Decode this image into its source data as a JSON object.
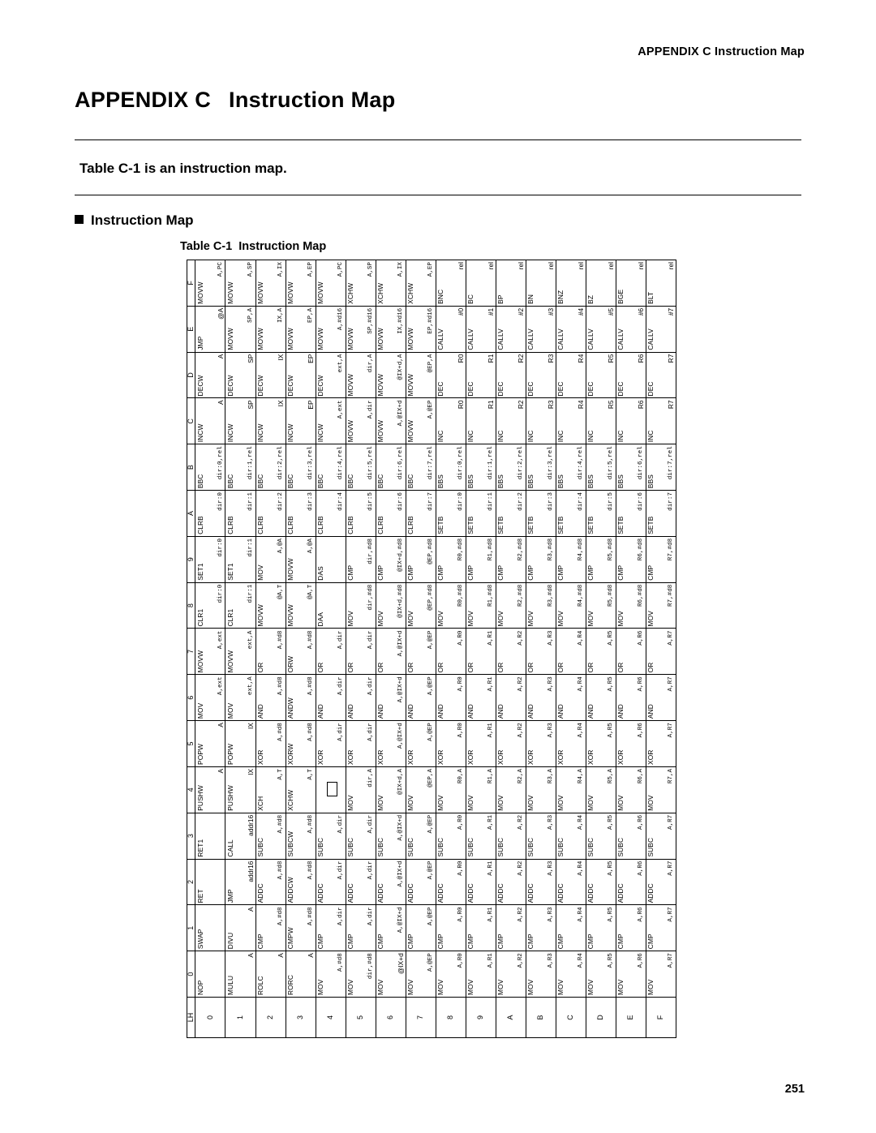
{
  "header": {
    "running_head": "APPENDIX C  Instruction Map",
    "page_number": "251"
  },
  "title": {
    "label": "APPENDIX C",
    "name": "Instruction Map"
  },
  "subtitle": "Table C-1 is an instruction map.",
  "section": "Instruction Map",
  "table_caption": {
    "number": "Table C-1",
    "text": "Instruction Map"
  },
  "table": {
    "corner": "LH",
    "col_headers": [
      "0",
      "1",
      "2",
      "3",
      "4",
      "5",
      "6",
      "7",
      "8",
      "9",
      "A",
      "B",
      "C",
      "D",
      "E",
      "F"
    ],
    "row_headers": [
      "0",
      "1",
      "2",
      "3",
      "4",
      "5",
      "6",
      "7",
      "8",
      "9",
      "A",
      "B",
      "C",
      "D",
      "E",
      "F"
    ],
    "rows": [
      [
        {
          "m": "NOP",
          "o": ""
        },
        {
          "m": "SWAP",
          "o": ""
        },
        {
          "m": "RET",
          "o": ""
        },
        {
          "m": "RET1",
          "o": ""
        },
        {
          "m": "PUSHW",
          "o": "A"
        },
        {
          "m": "POPW",
          "o": "A"
        },
        {
          "m": "MOV",
          "o": "A,ext"
        },
        {
          "m": "MOVW",
          "o": "A,ext"
        },
        {
          "m": "CLR1",
          "o": "dir:0"
        },
        {
          "m": "SET1",
          "o": "dir:0"
        },
        {
          "m": "CLRB",
          "o": "dir:0"
        },
        {
          "m": "BBC",
          "o": "dir:0,rel"
        },
        {
          "m": "INCW",
          "o": "A"
        },
        {
          "m": "DECW",
          "o": "A"
        },
        {
          "m": "JMP",
          "o": "@A"
        },
        {
          "m": "MOVW",
          "o": "A,PC"
        }
      ],
      [
        {
          "m": "MULU",
          "o": "A"
        },
        {
          "m": "DIVU",
          "o": "A"
        },
        {
          "m": "JMP",
          "o": "addr16"
        },
        {
          "m": "CALL",
          "o": "addr16"
        },
        {
          "m": "PUSHW",
          "o": "IX"
        },
        {
          "m": "POPW",
          "o": "IX"
        },
        {
          "m": "MOV",
          "o": "ext,A"
        },
        {
          "m": "MOVW",
          "o": "ext,A"
        },
        {
          "m": "CLR1",
          "o": "dir:1"
        },
        {
          "m": "SET1",
          "o": "dir:1"
        },
        {
          "m": "CLRB",
          "o": "dir:1"
        },
        {
          "m": "BBC",
          "o": "dir:1,rel"
        },
        {
          "m": "INCW",
          "o": "SP"
        },
        {
          "m": "DECW",
          "o": "SP"
        },
        {
          "m": "MOVW",
          "o": "SP,A"
        },
        {
          "m": "MOVW",
          "o": "A,SP"
        }
      ],
      [
        {
          "m": "ROLC",
          "o": "A"
        },
        {
          "m": "CMP",
          "o": "A,#d8"
        },
        {
          "m": "ADDC",
          "o": "A,#d8"
        },
        {
          "m": "SUBC",
          "o": "A,#d8"
        },
        {
          "m": "XCH",
          "o": "A,T"
        },
        {
          "m": "XOR",
          "o": "A,#d8"
        },
        {
          "m": "AND",
          "o": "A,#d8"
        },
        {
          "m": "OR",
          "o": "A,#d8"
        },
        {
          "m": "MOVW",
          "o": "@A,T"
        },
        {
          "m": "MOV",
          "o": "A,@A"
        },
        {
          "m": "CLRB",
          "o": "dir:2"
        },
        {
          "m": "BBC",
          "o": "dir:2,rel"
        },
        {
          "m": "INCW",
          "o": "IX"
        },
        {
          "m": "DECW",
          "o": "IX"
        },
        {
          "m": "MOVW",
          "o": "IX,A"
        },
        {
          "m": "MOVW",
          "o": "A,IX"
        }
      ],
      [
        {
          "m": "RORC",
          "o": "A"
        },
        {
          "m": "CMPW",
          "o": "A,#d8"
        },
        {
          "m": "ADDCW",
          "o": "A,#d8"
        },
        {
          "m": "SUBCW",
          "o": "A,#d8"
        },
        {
          "m": "XCHW",
          "o": "A,T"
        },
        {
          "m": "XORW",
          "o": "A,#d8"
        },
        {
          "m": "ANDW",
          "o": "A,#d8"
        },
        {
          "m": "ORW",
          "o": "A,#d8"
        },
        {
          "m": "MOVW",
          "o": "@A,T"
        },
        {
          "m": "MOVW",
          "o": "A,@A"
        },
        {
          "m": "CLRB",
          "o": "dir:3"
        },
        {
          "m": "BBC",
          "o": "dir:3,rel"
        },
        {
          "m": "INCW",
          "o": "EP"
        },
        {
          "m": "DECW",
          "o": "EP"
        },
        {
          "m": "MOVW",
          "o": "EP,A"
        },
        {
          "m": "MOVW",
          "o": "A,EP"
        }
      ],
      [
        {
          "m": "MOV",
          "o": "A,#d8"
        },
        {
          "m": "CMP",
          "o": "A,dir"
        },
        {
          "m": "ADDC",
          "o": "A,dir"
        },
        {
          "m": "SUBC",
          "o": "A,dir"
        },
        {
          "m": "BOX",
          "o": ""
        },
        {
          "m": "XOR",
          "o": "A,dir"
        },
        {
          "m": "AND",
          "o": "A,dir"
        },
        {
          "m": "OR",
          "o": "A,dir"
        },
        {
          "m": "DAA",
          "o": ""
        },
        {
          "m": "DAS",
          "o": ""
        },
        {
          "m": "CLRB",
          "o": "dir:4"
        },
        {
          "m": "BBC",
          "o": "dir:4,rel"
        },
        {
          "m": "INCW",
          "o": "A,ext"
        },
        {
          "m": "DECW",
          "o": "ext,A"
        },
        {
          "m": "MOVW",
          "o": "A,#d16"
        },
        {
          "m": "MOVW",
          "o": "A,PC"
        }
      ],
      [
        {
          "m": "MOV",
          "o": "dir,#d8"
        },
        {
          "m": "CMP",
          "o": "A,dir"
        },
        {
          "m": "ADDC",
          "o": "A,dir"
        },
        {
          "m": "SUBC",
          "o": "A,dir"
        },
        {
          "m": "MOV",
          "o": "dir,A"
        },
        {
          "m": "XOR",
          "o": "A,dir"
        },
        {
          "m": "AND",
          "o": "A,dir"
        },
        {
          "m": "OR",
          "o": "A,dir"
        },
        {
          "m": "MOV",
          "o": "dir,#d8"
        },
        {
          "m": "CMP",
          "o": "dir,#d8"
        },
        {
          "m": "CLRB",
          "o": "dir:5"
        },
        {
          "m": "BBC",
          "o": "dir:5,rel"
        },
        {
          "m": "MOVW",
          "o": "A,dir"
        },
        {
          "m": "MOVW",
          "o": "dir,A"
        },
        {
          "m": "MOVW",
          "o": "SP,#d16"
        },
        {
          "m": "XCHW",
          "o": "A,SP"
        }
      ],
      [
        {
          "m": "MOV",
          "o": "@IX+d"
        },
        {
          "m": "CMP",
          "o": "A,@IX+d"
        },
        {
          "m": "ADDC",
          "o": "A,@IX+d"
        },
        {
          "m": "SUBC",
          "o": "A,@IX+d"
        },
        {
          "m": "MOV",
          "o": "@IX+d,A"
        },
        {
          "m": "XOR",
          "o": "A,@IX+d"
        },
        {
          "m": "AND",
          "o": "A,@IX+d"
        },
        {
          "m": "OR",
          "o": "A,@IX+d"
        },
        {
          "m": "MOV",
          "o": "@IX+d,#d8"
        },
        {
          "m": "CMP",
          "o": "@IX+d,#d8"
        },
        {
          "m": "CLRB",
          "o": "dir:6"
        },
        {
          "m": "BBC",
          "o": "dir:6,rel"
        },
        {
          "m": "MOVW",
          "o": "A,@IX+d"
        },
        {
          "m": "MOVW",
          "o": "@IX+d,A"
        },
        {
          "m": "MOVW",
          "o": "IX,#d16"
        },
        {
          "m": "XCHW",
          "o": "A,IX"
        }
      ],
      [
        {
          "m": "MOV",
          "o": "A,@EP"
        },
        {
          "m": "CMP",
          "o": "A,@EP"
        },
        {
          "m": "ADDC",
          "o": "A,@EP"
        },
        {
          "m": "SUBC",
          "o": "A,@EP"
        },
        {
          "m": "MOV",
          "o": "@EP,A"
        },
        {
          "m": "XOR",
          "o": "A,@EP"
        },
        {
          "m": "AND",
          "o": "A,@EP"
        },
        {
          "m": "OR",
          "o": "A,@EP"
        },
        {
          "m": "MOV",
          "o": "@EP,#d8"
        },
        {
          "m": "CMP",
          "o": "@EP,#d8"
        },
        {
          "m": "CLRB",
          "o": "dir:7"
        },
        {
          "m": "BBC",
          "o": "dir:7,rel"
        },
        {
          "m": "MOVW",
          "o": "A,@EP"
        },
        {
          "m": "MOVW",
          "o": "@EP,A"
        },
        {
          "m": "MOVW",
          "o": "EP,#d16"
        },
        {
          "m": "XCHW",
          "o": "A,EP"
        }
      ],
      [
        {
          "m": "MOV",
          "o": "A,R0"
        },
        {
          "m": "CMP",
          "o": "A,R0"
        },
        {
          "m": "ADDC",
          "o": "A,R0"
        },
        {
          "m": "SUBC",
          "o": "A,R0"
        },
        {
          "m": "MOV",
          "o": "R0,A"
        },
        {
          "m": "XOR",
          "o": "A,R0"
        },
        {
          "m": "AND",
          "o": "A,R0"
        },
        {
          "m": "OR",
          "o": "A,R0"
        },
        {
          "m": "MOV",
          "o": "R0,#d8"
        },
        {
          "m": "CMP",
          "o": "R0,#d8"
        },
        {
          "m": "SETB",
          "o": "dir:0"
        },
        {
          "m": "BBS",
          "o": "dir:0,rel"
        },
        {
          "m": "INC",
          "o": "R0"
        },
        {
          "m": "DEC",
          "o": "R0"
        },
        {
          "m": "CALLV",
          "o": "#0"
        },
        {
          "m": "BNC",
          "o": "rel"
        }
      ],
      [
        {
          "m": "MOV",
          "o": "A,R1"
        },
        {
          "m": "CMP",
          "o": "A,R1"
        },
        {
          "m": "ADDC",
          "o": "A,R1"
        },
        {
          "m": "SUBC",
          "o": "A,R1"
        },
        {
          "m": "MOV",
          "o": "R1,A"
        },
        {
          "m": "XOR",
          "o": "A,R1"
        },
        {
          "m": "AND",
          "o": "A,R1"
        },
        {
          "m": "OR",
          "o": "A,R1"
        },
        {
          "m": "MOV",
          "o": "R1,#d8"
        },
        {
          "m": "CMP",
          "o": "R1,#d8"
        },
        {
          "m": "SETB",
          "o": "dir:1"
        },
        {
          "m": "BBS",
          "o": "dir:1,rel"
        },
        {
          "m": "INC",
          "o": "R1"
        },
        {
          "m": "DEC",
          "o": "R1"
        },
        {
          "m": "CALLV",
          "o": "#1"
        },
        {
          "m": "BC",
          "o": "rel"
        }
      ],
      [
        {
          "m": "MOV",
          "o": "A,R2"
        },
        {
          "m": "CMP",
          "o": "A,R2"
        },
        {
          "m": "ADDC",
          "o": "A,R2"
        },
        {
          "m": "SUBC",
          "o": "A,R2"
        },
        {
          "m": "MOV",
          "o": "R2,A"
        },
        {
          "m": "XOR",
          "o": "A,R2"
        },
        {
          "m": "AND",
          "o": "A,R2"
        },
        {
          "m": "OR",
          "o": "A,R2"
        },
        {
          "m": "MOV",
          "o": "R2,#d8"
        },
        {
          "m": "CMP",
          "o": "R2,#d8"
        },
        {
          "m": "SETB",
          "o": "dir:2"
        },
        {
          "m": "BBS",
          "o": "dir:2,rel"
        },
        {
          "m": "INC",
          "o": "R2"
        },
        {
          "m": "DEC",
          "o": "R2"
        },
        {
          "m": "CALLV",
          "o": "#2"
        },
        {
          "m": "BP",
          "o": "rel"
        }
      ],
      [
        {
          "m": "MOV",
          "o": "A,R3"
        },
        {
          "m": "CMP",
          "o": "A,R3"
        },
        {
          "m": "ADDC",
          "o": "A,R3"
        },
        {
          "m": "SUBC",
          "o": "A,R3"
        },
        {
          "m": "MOV",
          "o": "R3,A"
        },
        {
          "m": "XOR",
          "o": "A,R3"
        },
        {
          "m": "AND",
          "o": "A,R3"
        },
        {
          "m": "OR",
          "o": "A,R3"
        },
        {
          "m": "MOV",
          "o": "R3,#d8"
        },
        {
          "m": "CMP",
          "o": "R3,#d8"
        },
        {
          "m": "SETB",
          "o": "dir:3"
        },
        {
          "m": "BBS",
          "o": "dir:3,rel"
        },
        {
          "m": "INC",
          "o": "R3"
        },
        {
          "m": "DEC",
          "o": "R3"
        },
        {
          "m": "CALLV",
          "o": "#3"
        },
        {
          "m": "BN",
          "o": "rel"
        }
      ],
      [
        {
          "m": "MOV",
          "o": "A,R4"
        },
        {
          "m": "CMP",
          "o": "A,R4"
        },
        {
          "m": "ADDC",
          "o": "A,R4"
        },
        {
          "m": "SUBC",
          "o": "A,R4"
        },
        {
          "m": "MOV",
          "o": "R4,A"
        },
        {
          "m": "XOR",
          "o": "A,R4"
        },
        {
          "m": "AND",
          "o": "A,R4"
        },
        {
          "m": "OR",
          "o": "A,R4"
        },
        {
          "m": "MOV",
          "o": "R4,#d8"
        },
        {
          "m": "CMP",
          "o": "R4,#d8"
        },
        {
          "m": "SETB",
          "o": "dir:4"
        },
        {
          "m": "BBS",
          "o": "dir:4,rel"
        },
        {
          "m": "INC",
          "o": "R4"
        },
        {
          "m": "DEC",
          "o": "R4"
        },
        {
          "m": "CALLV",
          "o": "#4"
        },
        {
          "m": "BNZ",
          "o": "rel"
        }
      ],
      [
        {
          "m": "MOV",
          "o": "A,R5"
        },
        {
          "m": "CMP",
          "o": "A,R5"
        },
        {
          "m": "ADDC",
          "o": "A,R5"
        },
        {
          "m": "SUBC",
          "o": "A,R5"
        },
        {
          "m": "MOV",
          "o": "R5,A"
        },
        {
          "m": "XOR",
          "o": "A,R5"
        },
        {
          "m": "AND",
          "o": "A,R5"
        },
        {
          "m": "OR",
          "o": "A,R5"
        },
        {
          "m": "MOV",
          "o": "R5,#d8"
        },
        {
          "m": "CMP",
          "o": "R5,#d8"
        },
        {
          "m": "SETB",
          "o": "dir:5"
        },
        {
          "m": "BBS",
          "o": "dir:5,rel"
        },
        {
          "m": "INC",
          "o": "R5"
        },
        {
          "m": "DEC",
          "o": "R5"
        },
        {
          "m": "CALLV",
          "o": "#5"
        },
        {
          "m": "BZ",
          "o": "rel"
        }
      ],
      [
        {
          "m": "MOV",
          "o": "A,R6"
        },
        {
          "m": "CMP",
          "o": "A,R6"
        },
        {
          "m": "ADDC",
          "o": "A,R6"
        },
        {
          "m": "SUBC",
          "o": "A,R6"
        },
        {
          "m": "MOV",
          "o": "R6,A"
        },
        {
          "m": "XOR",
          "o": "A,R6"
        },
        {
          "m": "AND",
          "o": "A,R6"
        },
        {
          "m": "OR",
          "o": "A,R6"
        },
        {
          "m": "MOV",
          "o": "R6,#d8"
        },
        {
          "m": "CMP",
          "o": "R6,#d8"
        },
        {
          "m": "SETB",
          "o": "dir:6"
        },
        {
          "m": "BBS",
          "o": "dir:6,rel"
        },
        {
          "m": "INC",
          "o": "R6"
        },
        {
          "m": "DEC",
          "o": "R6"
        },
        {
          "m": "CALLV",
          "o": "#6"
        },
        {
          "m": "BGE",
          "o": "rel"
        }
      ],
      [
        {
          "m": "MOV",
          "o": "A,R7"
        },
        {
          "m": "CMP",
          "o": "A,R7"
        },
        {
          "m": "ADDC",
          "o": "A,R7"
        },
        {
          "m": "SUBC",
          "o": "A,R7"
        },
        {
          "m": "MOV",
          "o": "R7,A"
        },
        {
          "m": "XOR",
          "o": "A,R7"
        },
        {
          "m": "AND",
          "o": "A,R7"
        },
        {
          "m": "OR",
          "o": "A,R7"
        },
        {
          "m": "MOV",
          "o": "R7,#d8"
        },
        {
          "m": "CMP",
          "o": "R7,#d8"
        },
        {
          "m": "SETB",
          "o": "dir:7"
        },
        {
          "m": "BBS",
          "o": "dir:7,rel"
        },
        {
          "m": "INC",
          "o": "R7"
        },
        {
          "m": "DEC",
          "o": "R7"
        },
        {
          "m": "CALLV",
          "o": "#7"
        },
        {
          "m": "BLT",
          "o": "rel"
        }
      ]
    ]
  }
}
